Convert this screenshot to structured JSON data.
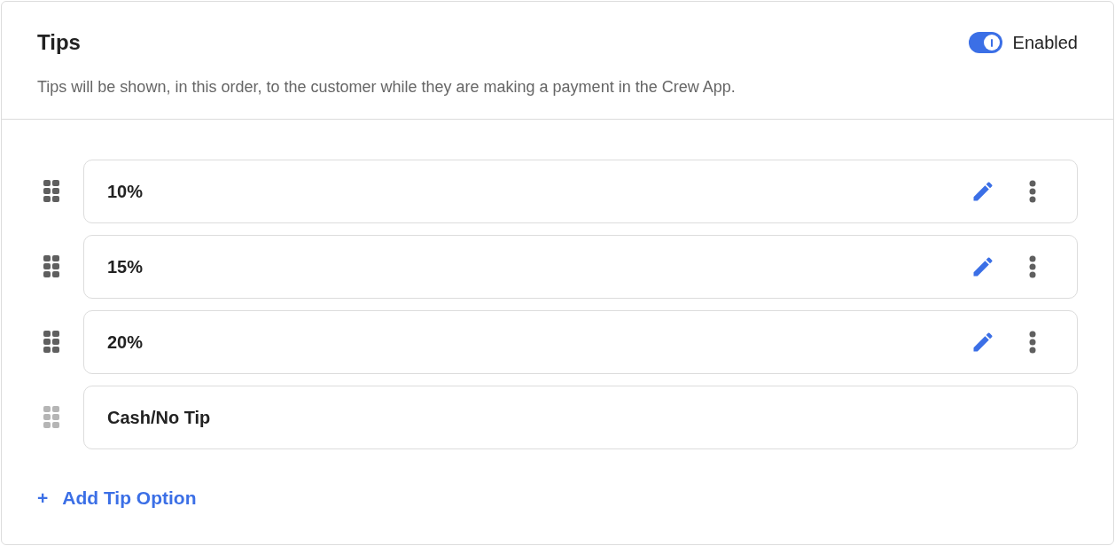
{
  "title": "Tips",
  "toggle": {
    "on": true,
    "label": "Enabled"
  },
  "description": "Tips will be shown, in this order, to the customer while they are making a payment in the Crew App.",
  "options": [
    {
      "label": "10%",
      "disabled": false
    },
    {
      "label": "15%",
      "disabled": false
    },
    {
      "label": "20%",
      "disabled": false
    },
    {
      "label": "Cash/No Tip",
      "disabled": true
    }
  ],
  "add_button": {
    "icon": "+",
    "label": "Add Tip Option"
  }
}
